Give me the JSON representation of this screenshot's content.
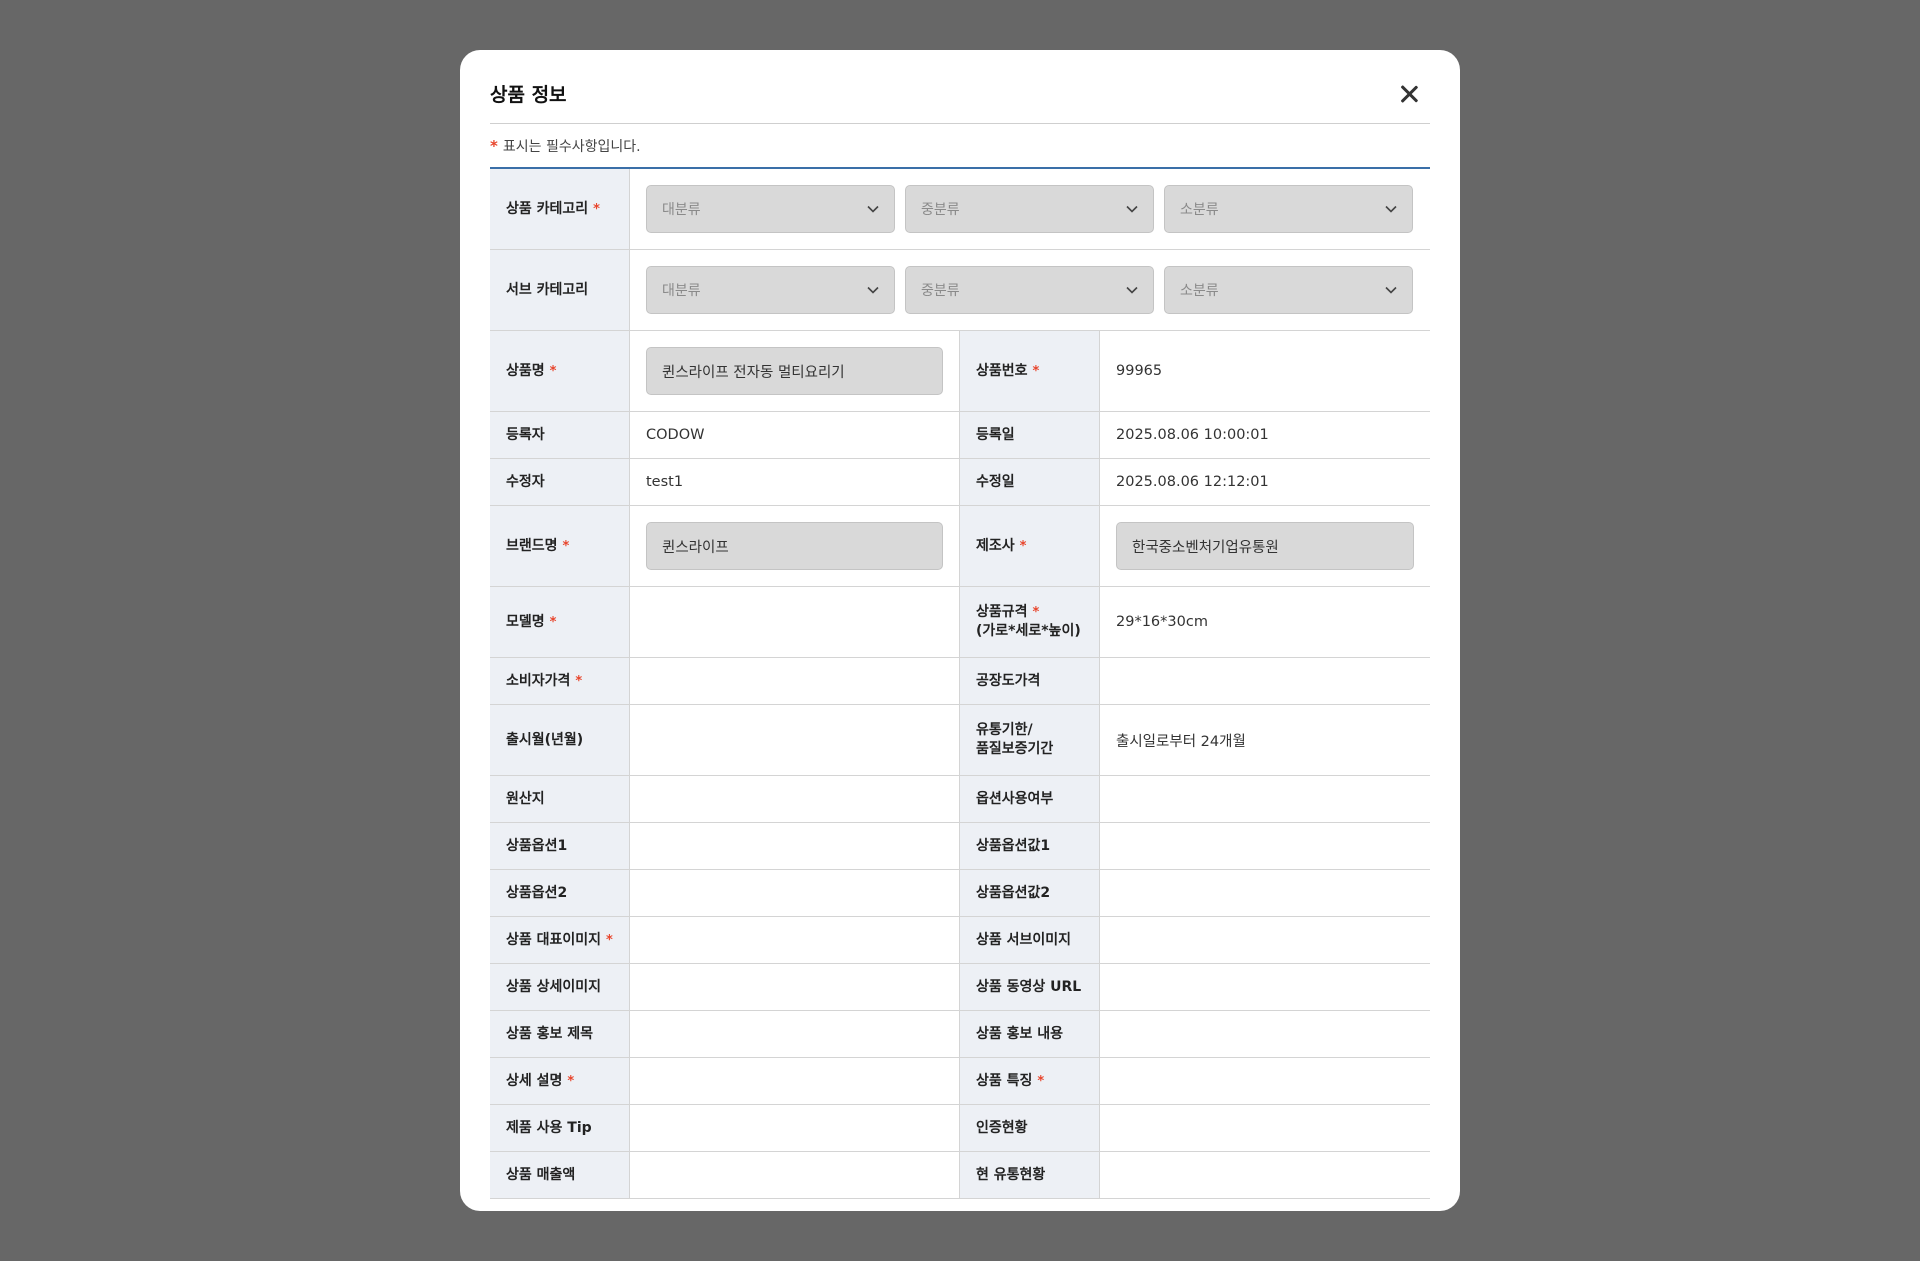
{
  "modal": {
    "title": "상품 정보"
  },
  "notice": {
    "star": "*",
    "text": "표시는 필수사항입니다."
  },
  "category": {
    "label": "상품 카테고리",
    "selects": [
      "대분류",
      "중분류",
      "소분류"
    ]
  },
  "subcategory": {
    "label": "서브 카테고리",
    "selects": [
      "대분류",
      "중분류",
      "소분류"
    ]
  },
  "fields": {
    "product_name": {
      "label": "상품명",
      "value": "퀸스라이프 전자동 멀티요리기"
    },
    "product_number": {
      "label": "상품번호",
      "value": "99965"
    },
    "registrant": {
      "label": "등록자",
      "value": "CODOW"
    },
    "reg_date": {
      "label": "등록일",
      "value": "2025.08.06 10:00:01"
    },
    "modifier": {
      "label": "수정자",
      "value": "test1"
    },
    "mod_date": {
      "label": "수정일",
      "value": "2025.08.06 12:12:01"
    },
    "brand": {
      "label": "브랜드명",
      "value": "퀸스라이프"
    },
    "manufacturer": {
      "label": "제조사",
      "value": "한국중소벤처기업유통원"
    },
    "model": {
      "label": "모델명",
      "value": ""
    },
    "spec": {
      "label": "상품규격",
      "label2": "(가로*세로*높이)",
      "value": "29*16*30cm"
    },
    "consumer_price": {
      "label": "소비자가격",
      "value": ""
    },
    "factory_price": {
      "label": "공장도가격",
      "value": ""
    },
    "release": {
      "label": "출시월(년월)",
      "value": ""
    },
    "expiry": {
      "label": "유통기한/",
      "label2": "품질보증기간",
      "value": "출시일로부터 24개월"
    },
    "origin": {
      "label": "원산지",
      "value": ""
    },
    "option_use": {
      "label": "옵션사용여부",
      "value": ""
    },
    "option1": {
      "label": "상품옵션1",
      "value": ""
    },
    "option_value1": {
      "label": "상품옵션값1",
      "value": ""
    },
    "option2": {
      "label": "상품옵션2",
      "value": ""
    },
    "option_value2": {
      "label": "상품옵션값2",
      "value": ""
    },
    "main_image": {
      "label": "상품 대표이미지",
      "value": ""
    },
    "sub_image": {
      "label": "상품 서브이미지",
      "value": ""
    },
    "detail_image": {
      "label": "상품 상세이미지",
      "value": ""
    },
    "video_url": {
      "label": "상품 동영상 URL",
      "value": ""
    },
    "promo_title": {
      "label": "상품 홍보 제목",
      "value": ""
    },
    "promo_content": {
      "label": "상품 홍보 내용",
      "value": ""
    },
    "detail_desc": {
      "label": "상세 설명",
      "value": ""
    },
    "features": {
      "label": "상품 특징",
      "value": ""
    },
    "usage_tip": {
      "label": "제품 사용 Tip",
      "value": ""
    },
    "certification": {
      "label": "인증현황",
      "value": ""
    },
    "sales": {
      "label": "상품 매출액",
      "value": ""
    },
    "distribution": {
      "label": "현 유통현황",
      "value": ""
    }
  },
  "required_mark": "*"
}
